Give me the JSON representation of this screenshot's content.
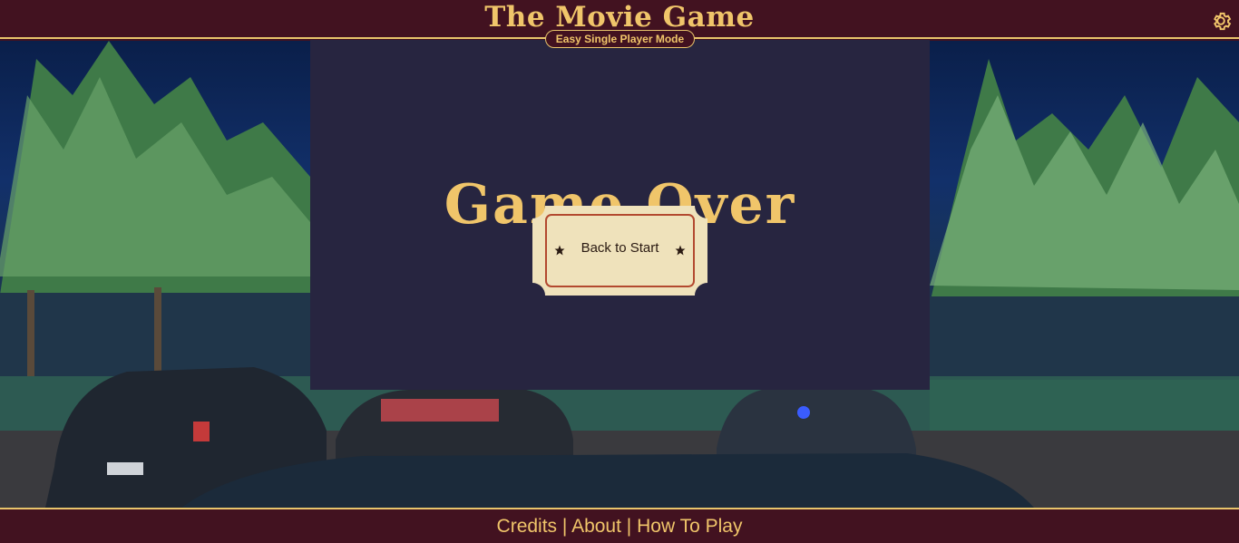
{
  "header": {
    "title": "The Movie Game",
    "mode_badge": "Easy Single Player Mode",
    "settings_icon": "gear-icon"
  },
  "main": {
    "heading": "Game Over",
    "back_button_label": "Back to Start",
    "back_button_icons": [
      "star-icon",
      "star-icon"
    ]
  },
  "footer": {
    "links": [
      "Credits",
      "About",
      "How To Play"
    ],
    "separator": "|"
  },
  "colors": {
    "header_bg": "#421220",
    "accent_gold": "#f0c56a",
    "panel_bg": "#272540",
    "ticket_paper": "#efe2bb",
    "ticket_border": "#b3492f"
  }
}
